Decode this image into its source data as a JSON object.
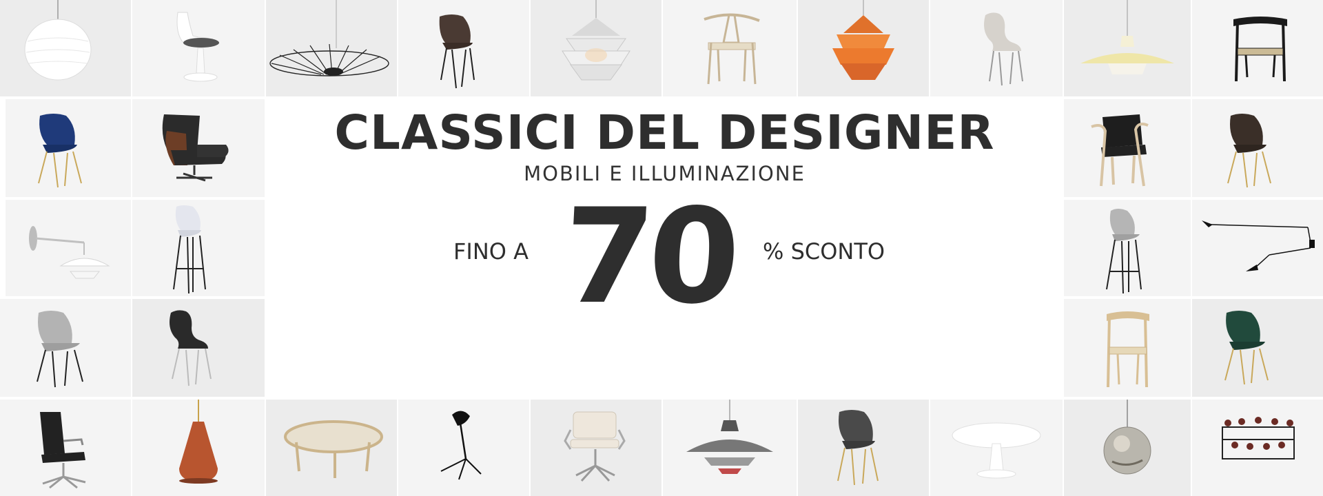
{
  "banner": {
    "headline": "CLASSICI DEL DESIGNER",
    "subheadline": "MOBILI E ILLUMINAZIONE",
    "prefix": "FINO A",
    "discount_value": "70",
    "suffix": "% SCONTO"
  },
  "colors": {
    "text_dark": "#2e2e2e",
    "tile_light": "#f3f3f3",
    "tile_mid": "#ececec",
    "orange_lamp": "#ef7d2d",
    "copper_lamp": "#b8552f",
    "navy_chair": "#1f3a7a",
    "green_chair": "#214a3c",
    "brass": "#c9a85a"
  },
  "tiles": [
    {
      "name": "paper-ball-pendant-lamp-tile",
      "icon": "pendant-lamp"
    },
    {
      "name": "tulip-chair-tile",
      "icon": "tulip-chair"
    },
    {
      "name": "wire-pendant-lamp-tile",
      "icon": "wire-lamp"
    },
    {
      "name": "brown-leather-chair-tile",
      "icon": "shell-chair"
    },
    {
      "name": "artichoke-white-lamp-tile",
      "icon": "artichoke-lamp"
    },
    {
      "name": "wishbone-chair-tile",
      "icon": "wishbone-chair"
    },
    {
      "name": "artichoke-copper-lamp-tile",
      "icon": "artichoke-lamp"
    },
    {
      "name": "series-7-grey-chair-tile",
      "icon": "stacking-chair"
    },
    {
      "name": "yellow-pendant-lamp-tile",
      "icon": "pendant-lamp"
    },
    {
      "name": "black-dining-chair-tile",
      "icon": "dining-chair"
    },
    {
      "name": "navy-velvet-chair-tile",
      "icon": "shell-chair"
    },
    {
      "name": "lounge-chair-ottoman-tile",
      "icon": "lounge-chair"
    },
    {
      "name": "leather-armchair-tile",
      "icon": "armchair"
    },
    {
      "name": "brown-shell-chair-tile",
      "icon": "shell-chair"
    },
    {
      "name": "wall-lamp-tile",
      "icon": "wall-lamp"
    },
    {
      "name": "white-bar-stool-tile",
      "icon": "bar-stool"
    },
    {
      "name": "grey-bar-stool-tile",
      "icon": "bar-stool"
    },
    {
      "name": "three-arm-wall-lamp-tile",
      "icon": "arm-lamp"
    },
    {
      "name": "grey-shell-chair-tile",
      "icon": "shell-chair"
    },
    {
      "name": "black-series-7-chair-tile",
      "icon": "stacking-chair"
    },
    {
      "name": "oak-dining-chair-tile",
      "icon": "dining-chair"
    },
    {
      "name": "green-velvet-chair-tile",
      "icon": "shell-chair"
    },
    {
      "name": "office-chair-tile",
      "icon": "office-chair"
    },
    {
      "name": "copper-pendant-lamp-tile",
      "icon": "pendant-lamp"
    },
    {
      "name": "oval-coffee-table-tile",
      "icon": "coffee-table"
    },
    {
      "name": "desk-lamp-tile",
      "icon": "desk-lamp"
    },
    {
      "name": "white-soft-pad-chair-tile",
      "icon": "office-chair"
    },
    {
      "name": "ph5-pendant-lamp-tile",
      "icon": "pendant-lamp"
    },
    {
      "name": "fabric-shell-chair-tile",
      "icon": "shell-chair"
    },
    {
      "name": "marble-tulip-table-tile",
      "icon": "tulip-table"
    },
    {
      "name": "mirror-ball-pendant-lamp-tile",
      "icon": "pendant-lamp"
    },
    {
      "name": "hang-it-all-coat-rack-tile",
      "icon": "coat-rack"
    }
  ]
}
